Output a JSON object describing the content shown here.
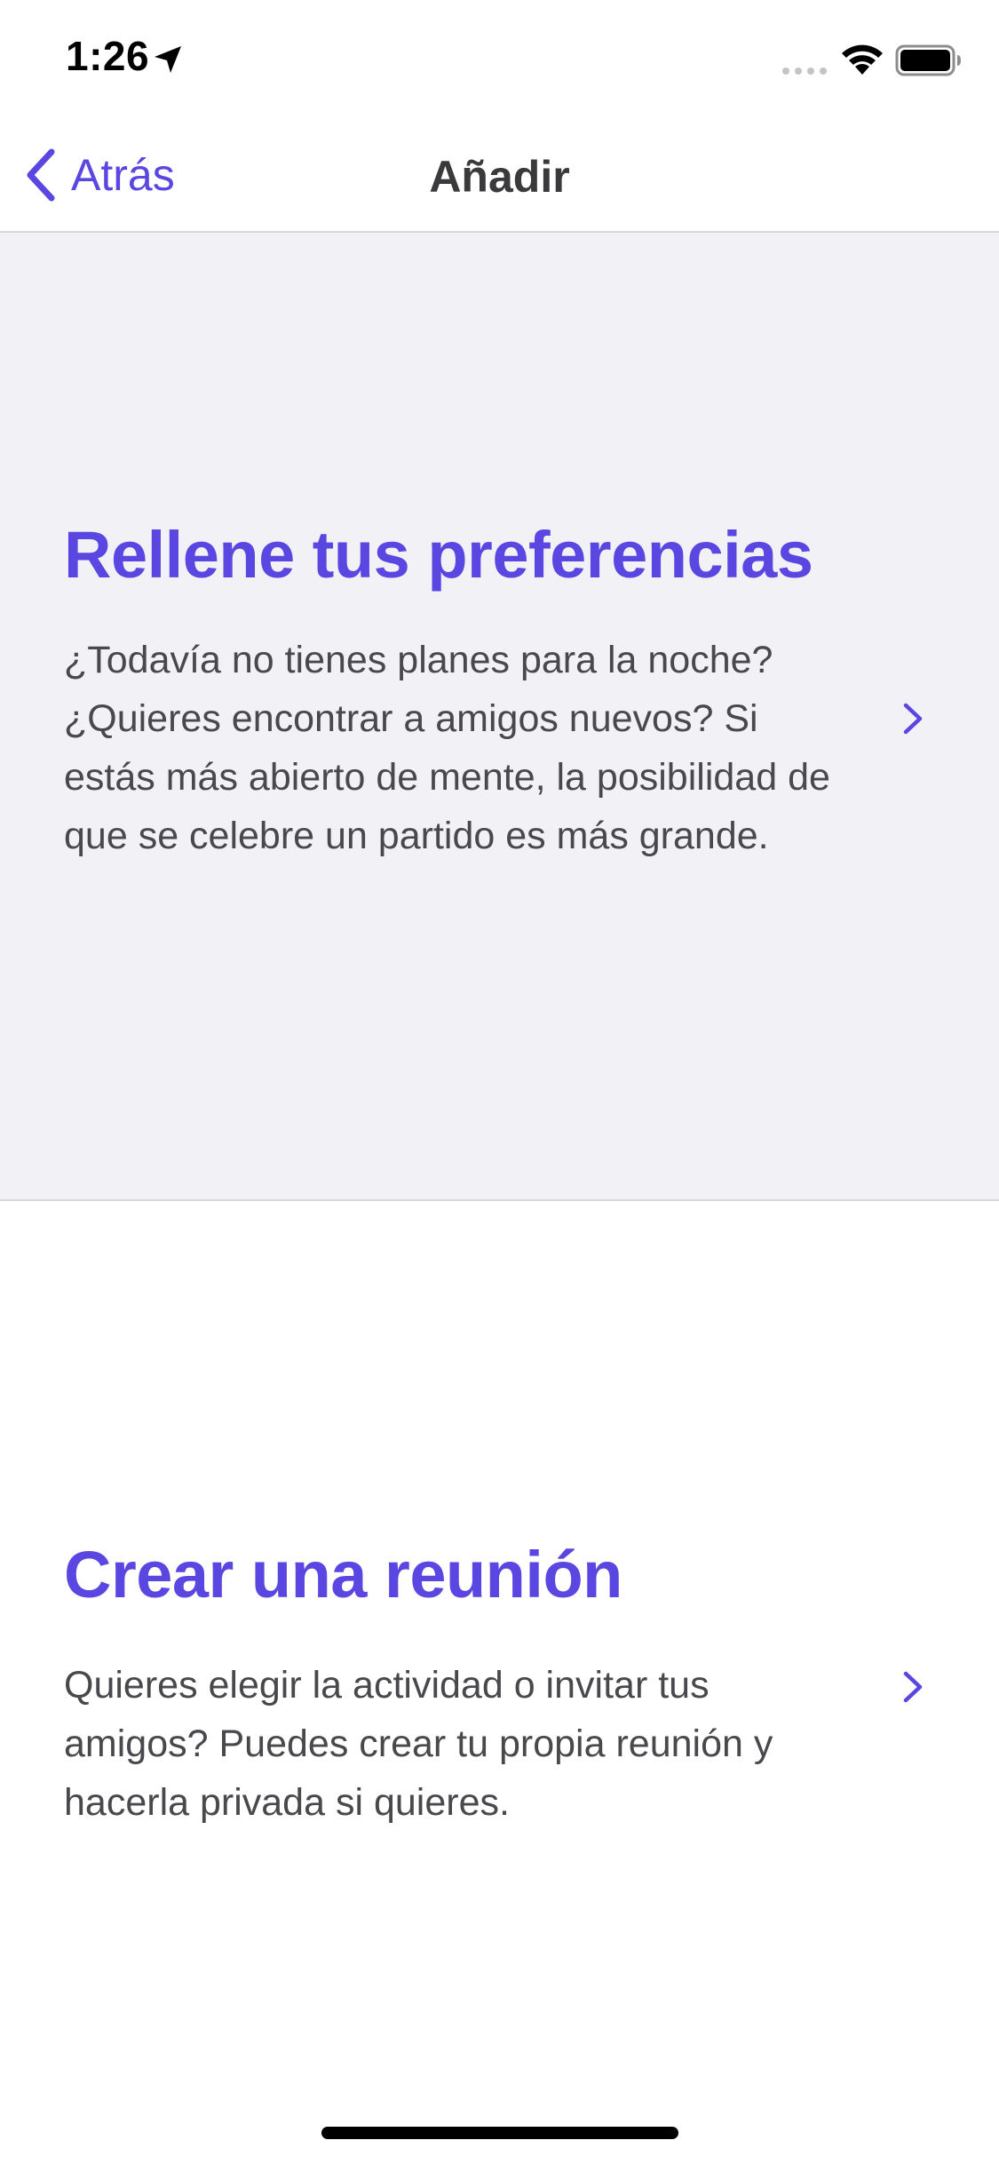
{
  "status_bar": {
    "time": "1:26",
    "icons": [
      "location-arrow-icon",
      "cellular-signal-icon",
      "wifi-icon",
      "battery-icon"
    ]
  },
  "nav": {
    "back_label": "Atrás",
    "title": "Añadir",
    "icons": [
      "chevron-left-icon"
    ]
  },
  "cards": [
    {
      "title": "Rellene tus preferencias",
      "description": "¿Todavía no tienes planes para la noche? ¿Quieres encontrar a amigos nuevos? Si estás más abierto de mente, la posibilidad de que se celebre un partido es más grande.",
      "icon": "chevron-right-icon"
    },
    {
      "title": "Crear una reunión",
      "description": "Quieres elegir la actividad o invitar tus amigos? Puedes crear tu propia reunión y hacerla privada si quieres.",
      "icon": "chevron-right-icon"
    }
  ],
  "colors": {
    "accent": "#5a46e0",
    "card_background": "#f2f2f6",
    "text": "#48484d",
    "divider": "#d6d6db"
  }
}
